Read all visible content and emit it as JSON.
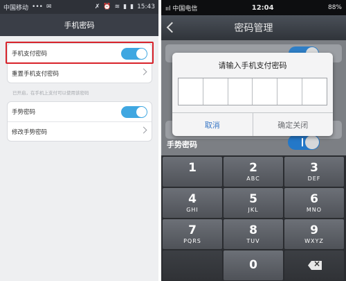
{
  "left": {
    "status": {
      "carrier": "中国移动",
      "dots": "•••",
      "time": "15:43",
      "battery": "▮"
    },
    "nav_title": "手机密码",
    "rows": [
      {
        "label": "手机支付密码",
        "type": "toggle",
        "on": true
      },
      {
        "label": "重置手机支付密码",
        "type": "arrow"
      }
    ],
    "hint": "已开启，在手机上支付可以使用该密码",
    "rows2": [
      {
        "label": "手势密码",
        "type": "toggle",
        "on": true
      },
      {
        "label": "修改手势密码",
        "type": "arrow"
      }
    ],
    "highlight_color": "#d8222a"
  },
  "right": {
    "status": {
      "carrier": "ııl 中国电信",
      "time": "12:04",
      "battery": "88%"
    },
    "nav_title": "密码管理",
    "dialog": {
      "title": "请输入手机支付密码",
      "box_count": 6,
      "cancel": "取消",
      "confirm": "确定关闭"
    },
    "gesture_label": "手势密码",
    "keypad": [
      {
        "num": "1",
        "letters": ""
      },
      {
        "num": "2",
        "letters": "ABC"
      },
      {
        "num": "3",
        "letters": "DEF"
      },
      {
        "num": "4",
        "letters": "GHI"
      },
      {
        "num": "5",
        "letters": "JKL"
      },
      {
        "num": "6",
        "letters": "MNO"
      },
      {
        "num": "7",
        "letters": "PQRS"
      },
      {
        "num": "8",
        "letters": "TUV"
      },
      {
        "num": "9",
        "letters": "WXYZ"
      },
      {
        "num": "0",
        "letters": ""
      }
    ]
  }
}
